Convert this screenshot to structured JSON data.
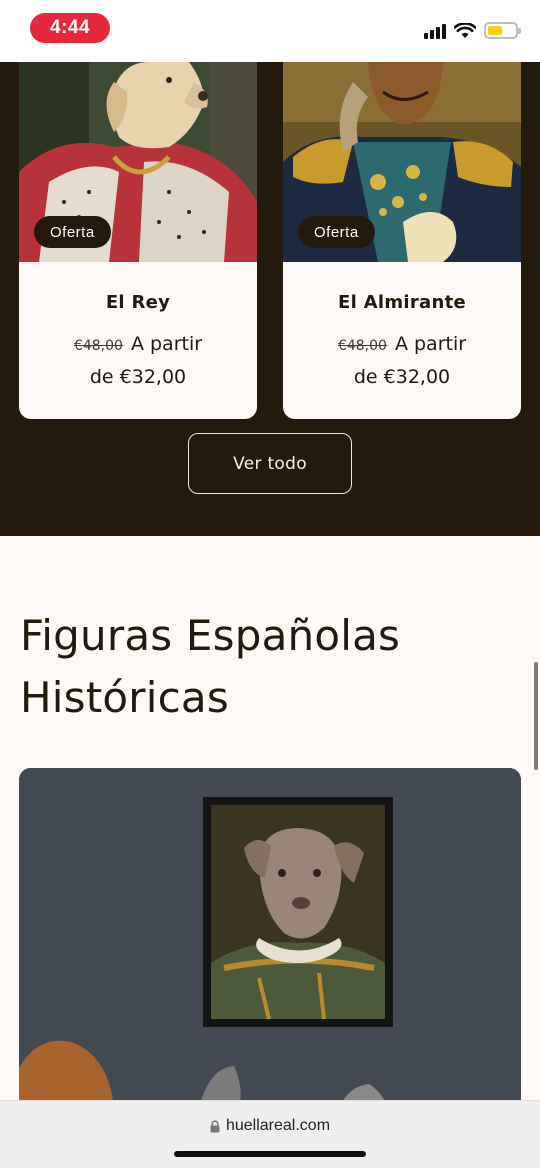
{
  "status_bar": {
    "time": "4:44",
    "icons": [
      "signal-icon",
      "wifi-icon",
      "battery-icon"
    ],
    "battery_color": "#f6d20b",
    "time_pill_color": "#e5283a"
  },
  "products": [
    {
      "badge": "Oferta",
      "title": "El Rey",
      "old_price": "€48,00",
      "price_prefix": "A partir",
      "price": "de €32,00"
    },
    {
      "badge": "Oferta",
      "title": "El Almirante",
      "old_price": "€48,00",
      "price_prefix": "A partir",
      "price": "de €32,00"
    }
  ],
  "view_all": {
    "label": "Ver todo"
  },
  "section": {
    "heading_line1": "Figuras Españolas",
    "heading_line2": "Históricas"
  },
  "browser": {
    "url": "huellareal.com"
  },
  "colors": {
    "dark_bg": "#231a0d",
    "light_bg": "#fdf9f6",
    "text": "#231a0d"
  }
}
